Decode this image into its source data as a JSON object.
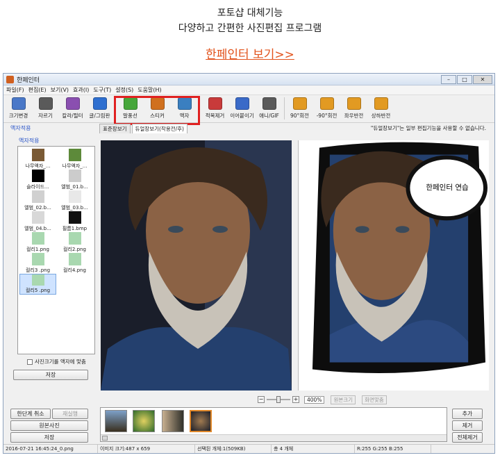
{
  "promo": {
    "line1": "포토샵 대체기능",
    "line2": "다양하고 간편한 사진편집 프로그램",
    "cta": "한페인터 보기>>"
  },
  "window": {
    "title": "한페인터",
    "controls": [
      "–",
      "□",
      "✕"
    ]
  },
  "menu": [
    "파일(F)",
    "편집(E)",
    "보기(V)",
    "효과(I)",
    "도구(T)",
    "설정(S)",
    "도움말(H)"
  ],
  "toolbar": [
    {
      "label": "크기변경",
      "color": "#4a78c8"
    },
    {
      "label": "자르기",
      "color": "#5a5a5a"
    },
    {
      "label": "칼라/필터",
      "color": "#8a4fb0"
    },
    {
      "label": "글/그림판",
      "color": "#2f6fd0"
    },
    {
      "label": "말풍선",
      "color": "#46a63a"
    },
    {
      "label": "스티커",
      "color": "#d0701e"
    },
    {
      "label": "액자",
      "color": "#3a7fc0"
    },
    {
      "label": "적목제거",
      "color": "#c83a3a"
    },
    {
      "label": "이어붙이기",
      "color": "#3a6ac8"
    },
    {
      "label": "애니/GIF",
      "color": "#5a5a5a"
    },
    {
      "label": "90°회전",
      "color": "#e29a22"
    },
    {
      "label": "-90°회전",
      "color": "#e29a22"
    },
    {
      "label": "좌우반전",
      "color": "#e29a22"
    },
    {
      "label": "상하반전",
      "color": "#e29a22"
    }
  ],
  "panel": {
    "title": "액자적용",
    "section": "액자적용",
    "items": [
      {
        "label": "나무액자_...",
        "color": "#7a5a35"
      },
      {
        "label": "나무액자_...",
        "color": "#5d8a3a"
      },
      {
        "label": "슬라이드...",
        "color": "#000000"
      },
      {
        "label": "엘범_01.b...",
        "color": "#cccccc"
      },
      {
        "label": "엘범_02.b...",
        "color": "#d0d0d0"
      },
      {
        "label": "엘범_03.b...",
        "color": "#e8e8e8"
      },
      {
        "label": "엘범_04.b...",
        "color": "#d8d8d8"
      },
      {
        "label": "필름1.bmp",
        "color": "#111111"
      },
      {
        "label": "컬리1.png",
        "color": "#a9d8b0"
      },
      {
        "label": "컬리2.png",
        "color": "#a9d8b0"
      },
      {
        "label": "컬리3 .png",
        "color": "#a9d8b0"
      },
      {
        "label": "컬리4.png",
        "color": "#a9d8b0"
      },
      {
        "label": "컬리5 .png",
        "color": "#a9d8b0"
      }
    ],
    "checkbox": "사진크기를 액자에 맞춤",
    "save": "저장"
  },
  "tabs": [
    "표준장보기",
    "듀얼장보기(작용전/후)"
  ],
  "notice": "\"듀얼장보기\"는 일부 편집기능을 사용할 수 없습니다.",
  "bubble": "한페인터 연습",
  "zoom": {
    "minus": "−",
    "plus": "+",
    "percent": "400%",
    "orig": "원본크기",
    "fit": "화면맞춤"
  },
  "bottom": {
    "undo": "한단계 취소",
    "redo": "재실행",
    "original": "원본사진",
    "save": "저장",
    "add": "추가",
    "remove": "제거",
    "remove_all": "전체제거"
  },
  "status": {
    "file": "2016-07-21 16:45:24_0.png",
    "size": "이미지 크기:487 x 659",
    "selected": "선택된 개체:1(509KB)",
    "total": "총 4 개체",
    "rgb": "R:255 G:255 B:255"
  }
}
